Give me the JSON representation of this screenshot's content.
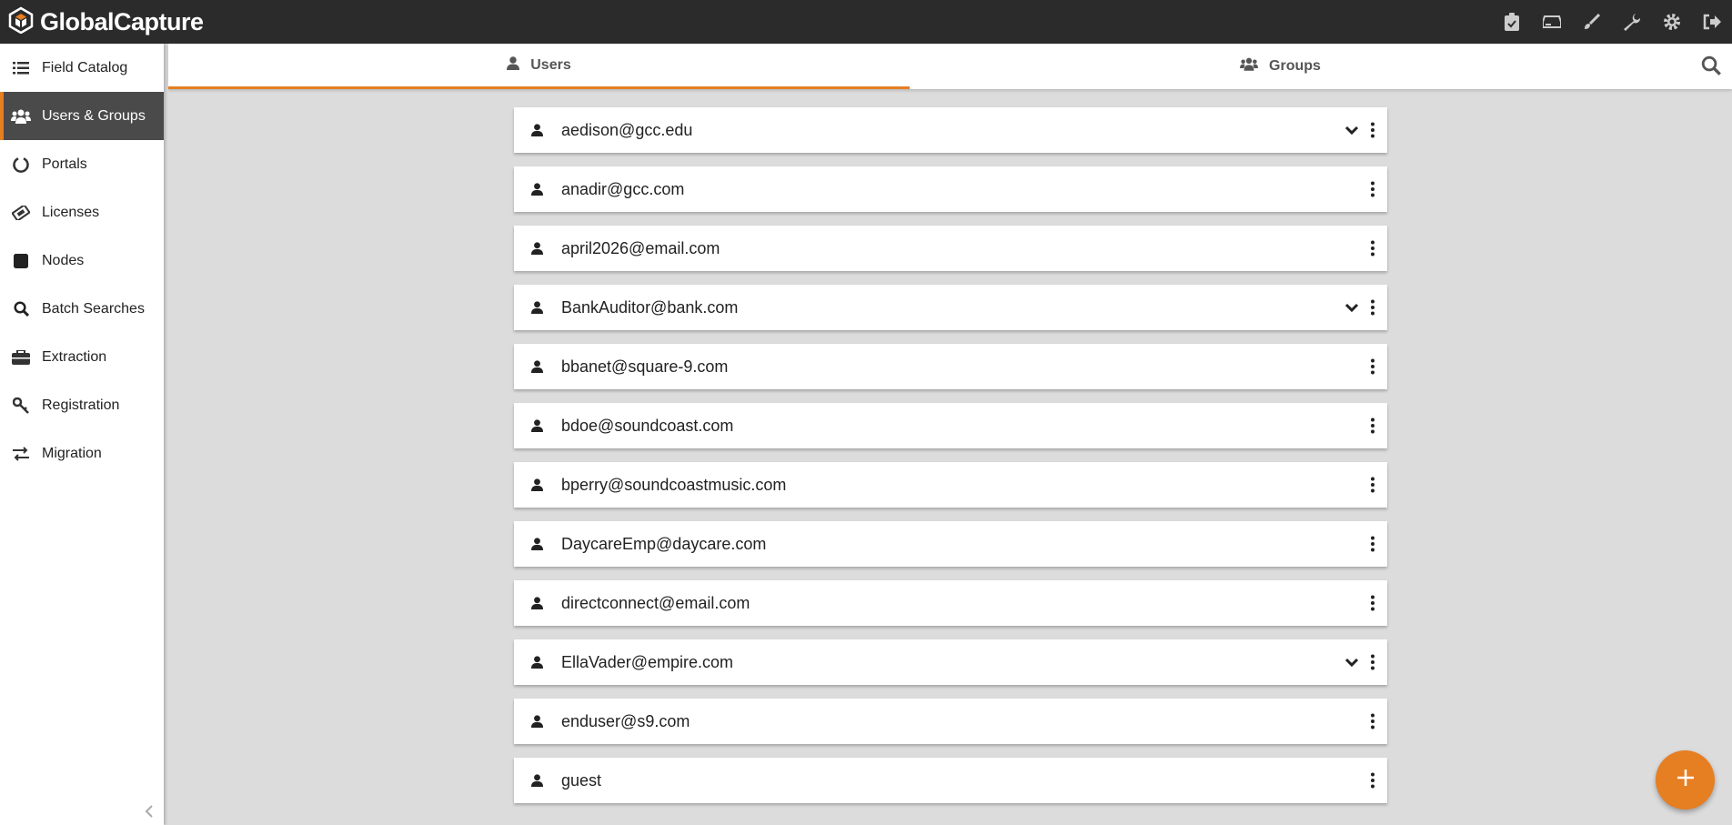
{
  "app": {
    "title": "GlobalCapture",
    "logo_icon": "hexagon-cube-logo",
    "accent": "#e67e22"
  },
  "topbar": {
    "icons": [
      "clipboard-check-icon",
      "inbox-tray-icon",
      "brush-icon",
      "wrench-icon",
      "gear-icon",
      "sign-out-icon"
    ]
  },
  "sidebar": {
    "items": [
      {
        "label": "Field Catalog",
        "icon": "list-icon"
      },
      {
        "label": "Users & Groups",
        "icon": "users-icon",
        "active": true
      },
      {
        "label": "Portals",
        "icon": "circle-notch-icon"
      },
      {
        "label": "Licenses",
        "icon": "ticket-icon"
      },
      {
        "label": "Nodes",
        "icon": "square-icon"
      },
      {
        "label": "Batch Searches",
        "icon": "search-icon"
      },
      {
        "label": "Extraction",
        "icon": "toolbox-icon"
      },
      {
        "label": "Registration",
        "icon": "key-icon"
      },
      {
        "label": "Migration",
        "icon": "exchange-icon"
      }
    ]
  },
  "tabs": {
    "users": "Users",
    "groups": "Groups"
  },
  "users": [
    {
      "email": "aedison@gcc.edu",
      "expandable": true
    },
    {
      "email": "anadir@gcc.com",
      "expandable": false
    },
    {
      "email": "april2026@email.com",
      "expandable": false
    },
    {
      "email": "BankAuditor@bank.com",
      "expandable": true
    },
    {
      "email": "bbanet@square-9.com",
      "expandable": false
    },
    {
      "email": "bdoe@soundcoast.com",
      "expandable": false
    },
    {
      "email": "bperry@soundcoastmusic.com",
      "expandable": false
    },
    {
      "email": "DaycareEmp@daycare.com",
      "expandable": false
    },
    {
      "email": "directconnect@email.com",
      "expandable": false
    },
    {
      "email": "EllaVader@empire.com",
      "expandable": true
    },
    {
      "email": "enduser@s9.com",
      "expandable": false
    },
    {
      "email": "guest",
      "expandable": false
    }
  ]
}
